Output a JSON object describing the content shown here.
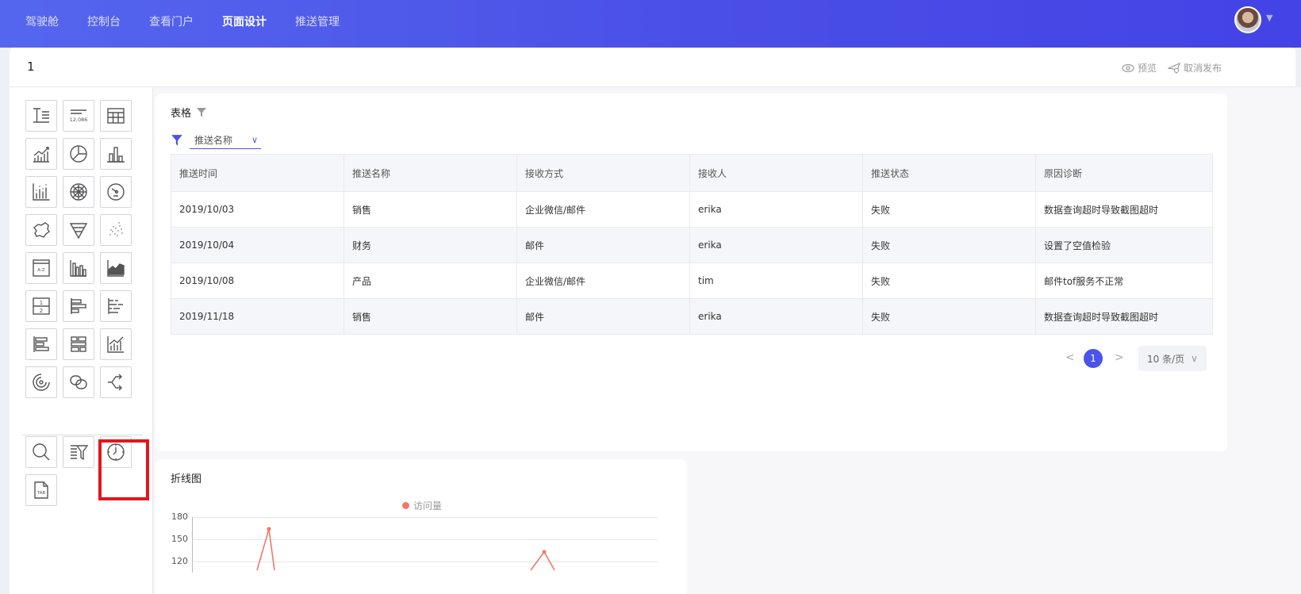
{
  "nav": {
    "items": [
      "驾驶舱",
      "控制台",
      "查看门户",
      "页面设计",
      "推送管理"
    ],
    "active_index": 3
  },
  "page": {
    "title": "1",
    "preview_label": "预览",
    "unpublish_label": "取消发布"
  },
  "palette": {
    "tools": [
      "text-tool-icon",
      "number-card-tool-icon",
      "table-tool-icon",
      "line-chart-tool-icon",
      "pie-chart-tool-icon",
      "bar-chart-tool-icon",
      "scatter-bar-tool-icon",
      "radar-chart-tool-icon",
      "gauge-tool-icon",
      "map-tool-icon",
      "funnel-tool-icon",
      "scatter-plot-tool-icon",
      "ranking-tool-icon",
      "grouped-bar-tool-icon",
      "area-chart-tool-icon",
      "fraction-tool-icon",
      "horizontal-bar-tool-icon",
      "stacked-horizontal-bar-tool-icon",
      "bar-list-tool-icon",
      "block-layout-tool-icon",
      "combo-chart-tool-icon",
      "ring-progress-tool-icon",
      "venn-tool-icon",
      "sankey-tool-icon"
    ],
    "controls": [
      "search-control-icon",
      "filter-control-icon",
      "time-control-icon",
      "tab-control-icon"
    ],
    "tab_icon_text": "TAB",
    "number_icon_text": "12,086",
    "az_icon_text": "A-Z"
  },
  "table_card": {
    "title": "表格",
    "filter_value": "推送名称",
    "columns": [
      "推送时间",
      "推送名称",
      "接收方式",
      "接收人",
      "推送状态",
      "原因诊断"
    ],
    "rows": [
      [
        "2019/10/03",
        "销售",
        "企业微信/邮件",
        "erika",
        "失败",
        "数据查询超时导致截图超时"
      ],
      [
        "2019/10/04",
        "财务",
        "邮件",
        "erika",
        "失败",
        "设置了空值检验"
      ],
      [
        "2019/10/08",
        "产品",
        "企业微信/邮件",
        "tim",
        "失败",
        "邮件tof服务不正常"
      ],
      [
        "2019/11/18",
        "销售",
        "邮件",
        "erika",
        "失败",
        "数据查询超时导致截图超时"
      ]
    ],
    "pagination": {
      "prev": "<",
      "current": "1",
      "next": ">",
      "page_size": "10 条/页"
    }
  },
  "line_card": {
    "title": "折线图",
    "chart_data": {
      "type": "line",
      "legend": [
        "访问量"
      ],
      "yticks": [
        "180",
        "150",
        "120"
      ],
      "series": [
        {
          "name": "访问量",
          "color": "#f07a68"
        }
      ]
    }
  },
  "colors": {
    "nav_start": "#5566ee",
    "nav_end": "#4343e6",
    "accent": "#4a54e8",
    "series": "#f07a68",
    "highlight": "#e5141e"
  }
}
